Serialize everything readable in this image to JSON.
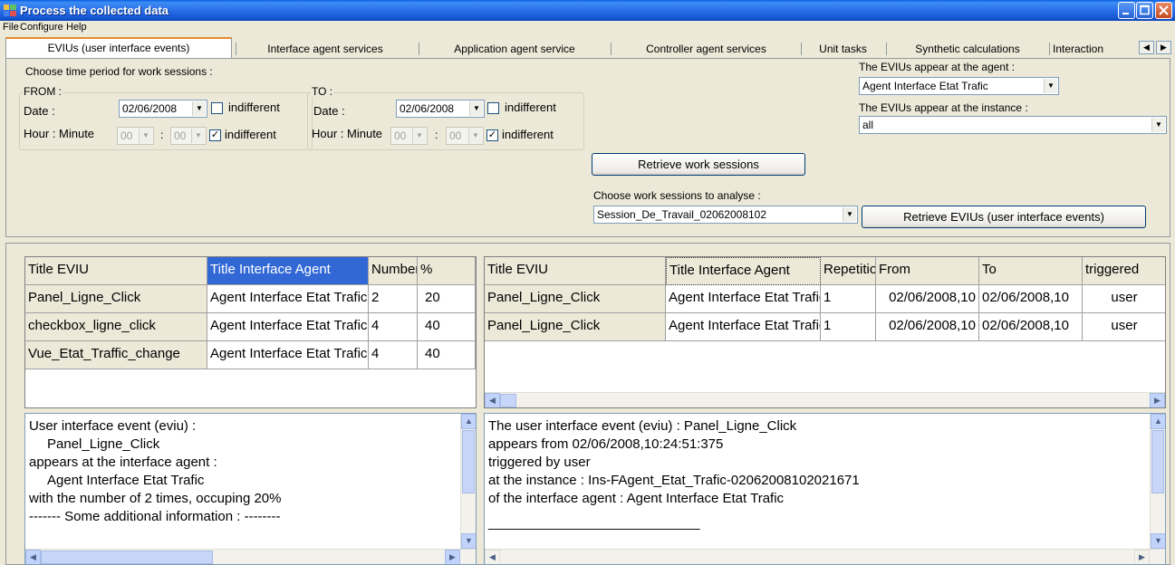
{
  "window": {
    "title": "Process the collected data"
  },
  "menu": [
    "File",
    "Configure",
    "Help"
  ],
  "tabs": [
    "EVIUs (user interface events)",
    "Interface agent services",
    "Application agent service",
    "Controller agent services",
    "Unit tasks",
    "Synthetic calculations",
    "Interaction"
  ],
  "filters": {
    "period_label": "Choose time period for work sessions :",
    "from": {
      "title": "FROM :",
      "date_label": "Date :",
      "date_value": "02/06/2008",
      "date_indifferent": "indifferent",
      "hour_label": "Hour : Minute",
      "hour_value": "00",
      "minute_value": "00",
      "hour_indifferent": "indifferent"
    },
    "to": {
      "title": "TO :",
      "date_label": "Date :",
      "date_value": "02/06/2008",
      "date_indifferent": "indifferent",
      "hour_label": "Hour : Minute",
      "hour_value": "00",
      "minute_value": "00",
      "hour_indifferent": "indifferent"
    },
    "retrieve_sessions_button": "Retrieve work sessions",
    "choose_sessions_label": "Choose work sessions to analyse :",
    "session_value": "Session_De_Travail_02062008102",
    "agent_label": "The EVIUs appear at the agent :",
    "agent_value": "Agent Interface Etat Trafic",
    "instance_label": "The EVIUs appear at the instance :",
    "instance_value": "all",
    "retrieve_evius_button": "Retrieve EVIUs (user interface events)"
  },
  "left_table": {
    "headers": [
      "Title EVIU",
      "Title Interface Agent",
      "Number",
      "%"
    ],
    "rows": [
      [
        "Panel_Ligne_Click",
        "Agent Interface Etat Trafic",
        "2",
        "20"
      ],
      [
        "checkbox_ligne_click",
        "Agent Interface Etat Trafic",
        "4",
        "40"
      ],
      [
        "Vue_Etat_Traffic_change",
        "Agent Interface Etat Trafic",
        "4",
        "40"
      ]
    ]
  },
  "right_table": {
    "headers": [
      "Title EVIU",
      "Title Interface Agent",
      "Repetitions",
      "From",
      "To",
      "triggered"
    ],
    "rows": [
      [
        "Panel_Ligne_Click",
        "Agent Interface Etat Trafic",
        "1",
        "02/06/2008,10",
        "02/06/2008,10",
        "user"
      ],
      [
        "Panel_Ligne_Click",
        "Agent Interface Etat Trafic",
        "1",
        "02/06/2008,10",
        "02/06/2008,10",
        "user"
      ]
    ]
  },
  "left_details": [
    "User interface event (eviu) :",
    "   Panel_Ligne_Click",
    "appears at the interface agent :",
    "   Agent Interface Etat Trafic",
    "with the number of 2 times, occuping 20%",
    "------- Some additional information : --------"
  ],
  "right_details": [
    "The user interface event (eviu) : Panel_Ligne_Click",
    "appears from 02/06/2008,10:24:51:375",
    "triggered by user",
    "at the instance : Ins-FAgent_Etat_Trafic-02062008102021671",
    "of the interface agent : Agent Interface Etat Trafic",
    "____________________________"
  ],
  "colors": {
    "titlebar": "#2a6fe8",
    "window_bg": "#ece9d8",
    "selection": "#3168d5",
    "active_tab_accent": "#e68b2c"
  }
}
